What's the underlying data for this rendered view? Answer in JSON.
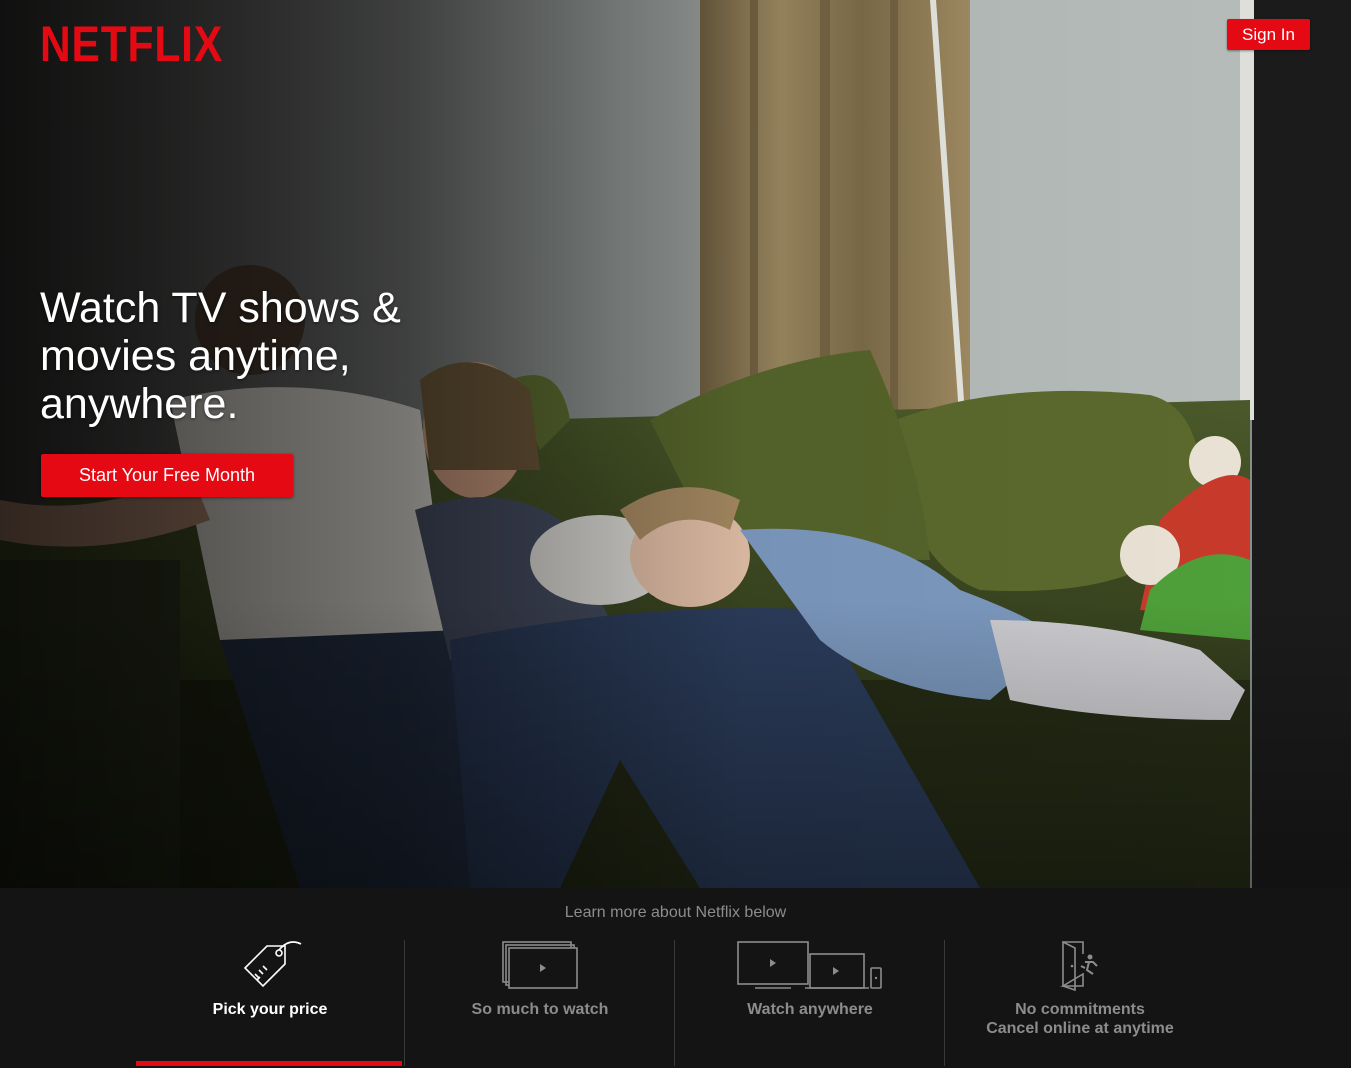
{
  "brand": {
    "logo_text": "NETFLIX",
    "accent_color": "#e50914"
  },
  "header": {
    "sign_in_label": "Sign In"
  },
  "hero": {
    "headline": "Watch TV shows & movies anytime, anywhere.",
    "cta_label": "Start Your Free Month"
  },
  "footer": {
    "learn_more": "Learn more about Netflix below",
    "tabs": [
      {
        "label": "Pick your price",
        "icon": "price-tag-icon",
        "active": true
      },
      {
        "label": "So much to watch",
        "icon": "stacked-screens-icon",
        "active": false
      },
      {
        "label": "Watch anywhere",
        "icon": "devices-icon",
        "active": false
      },
      {
        "label_line1": "No commitments",
        "label_line2": "Cancel online at anytime",
        "icon": "exit-door-icon",
        "active": false
      }
    ]
  }
}
